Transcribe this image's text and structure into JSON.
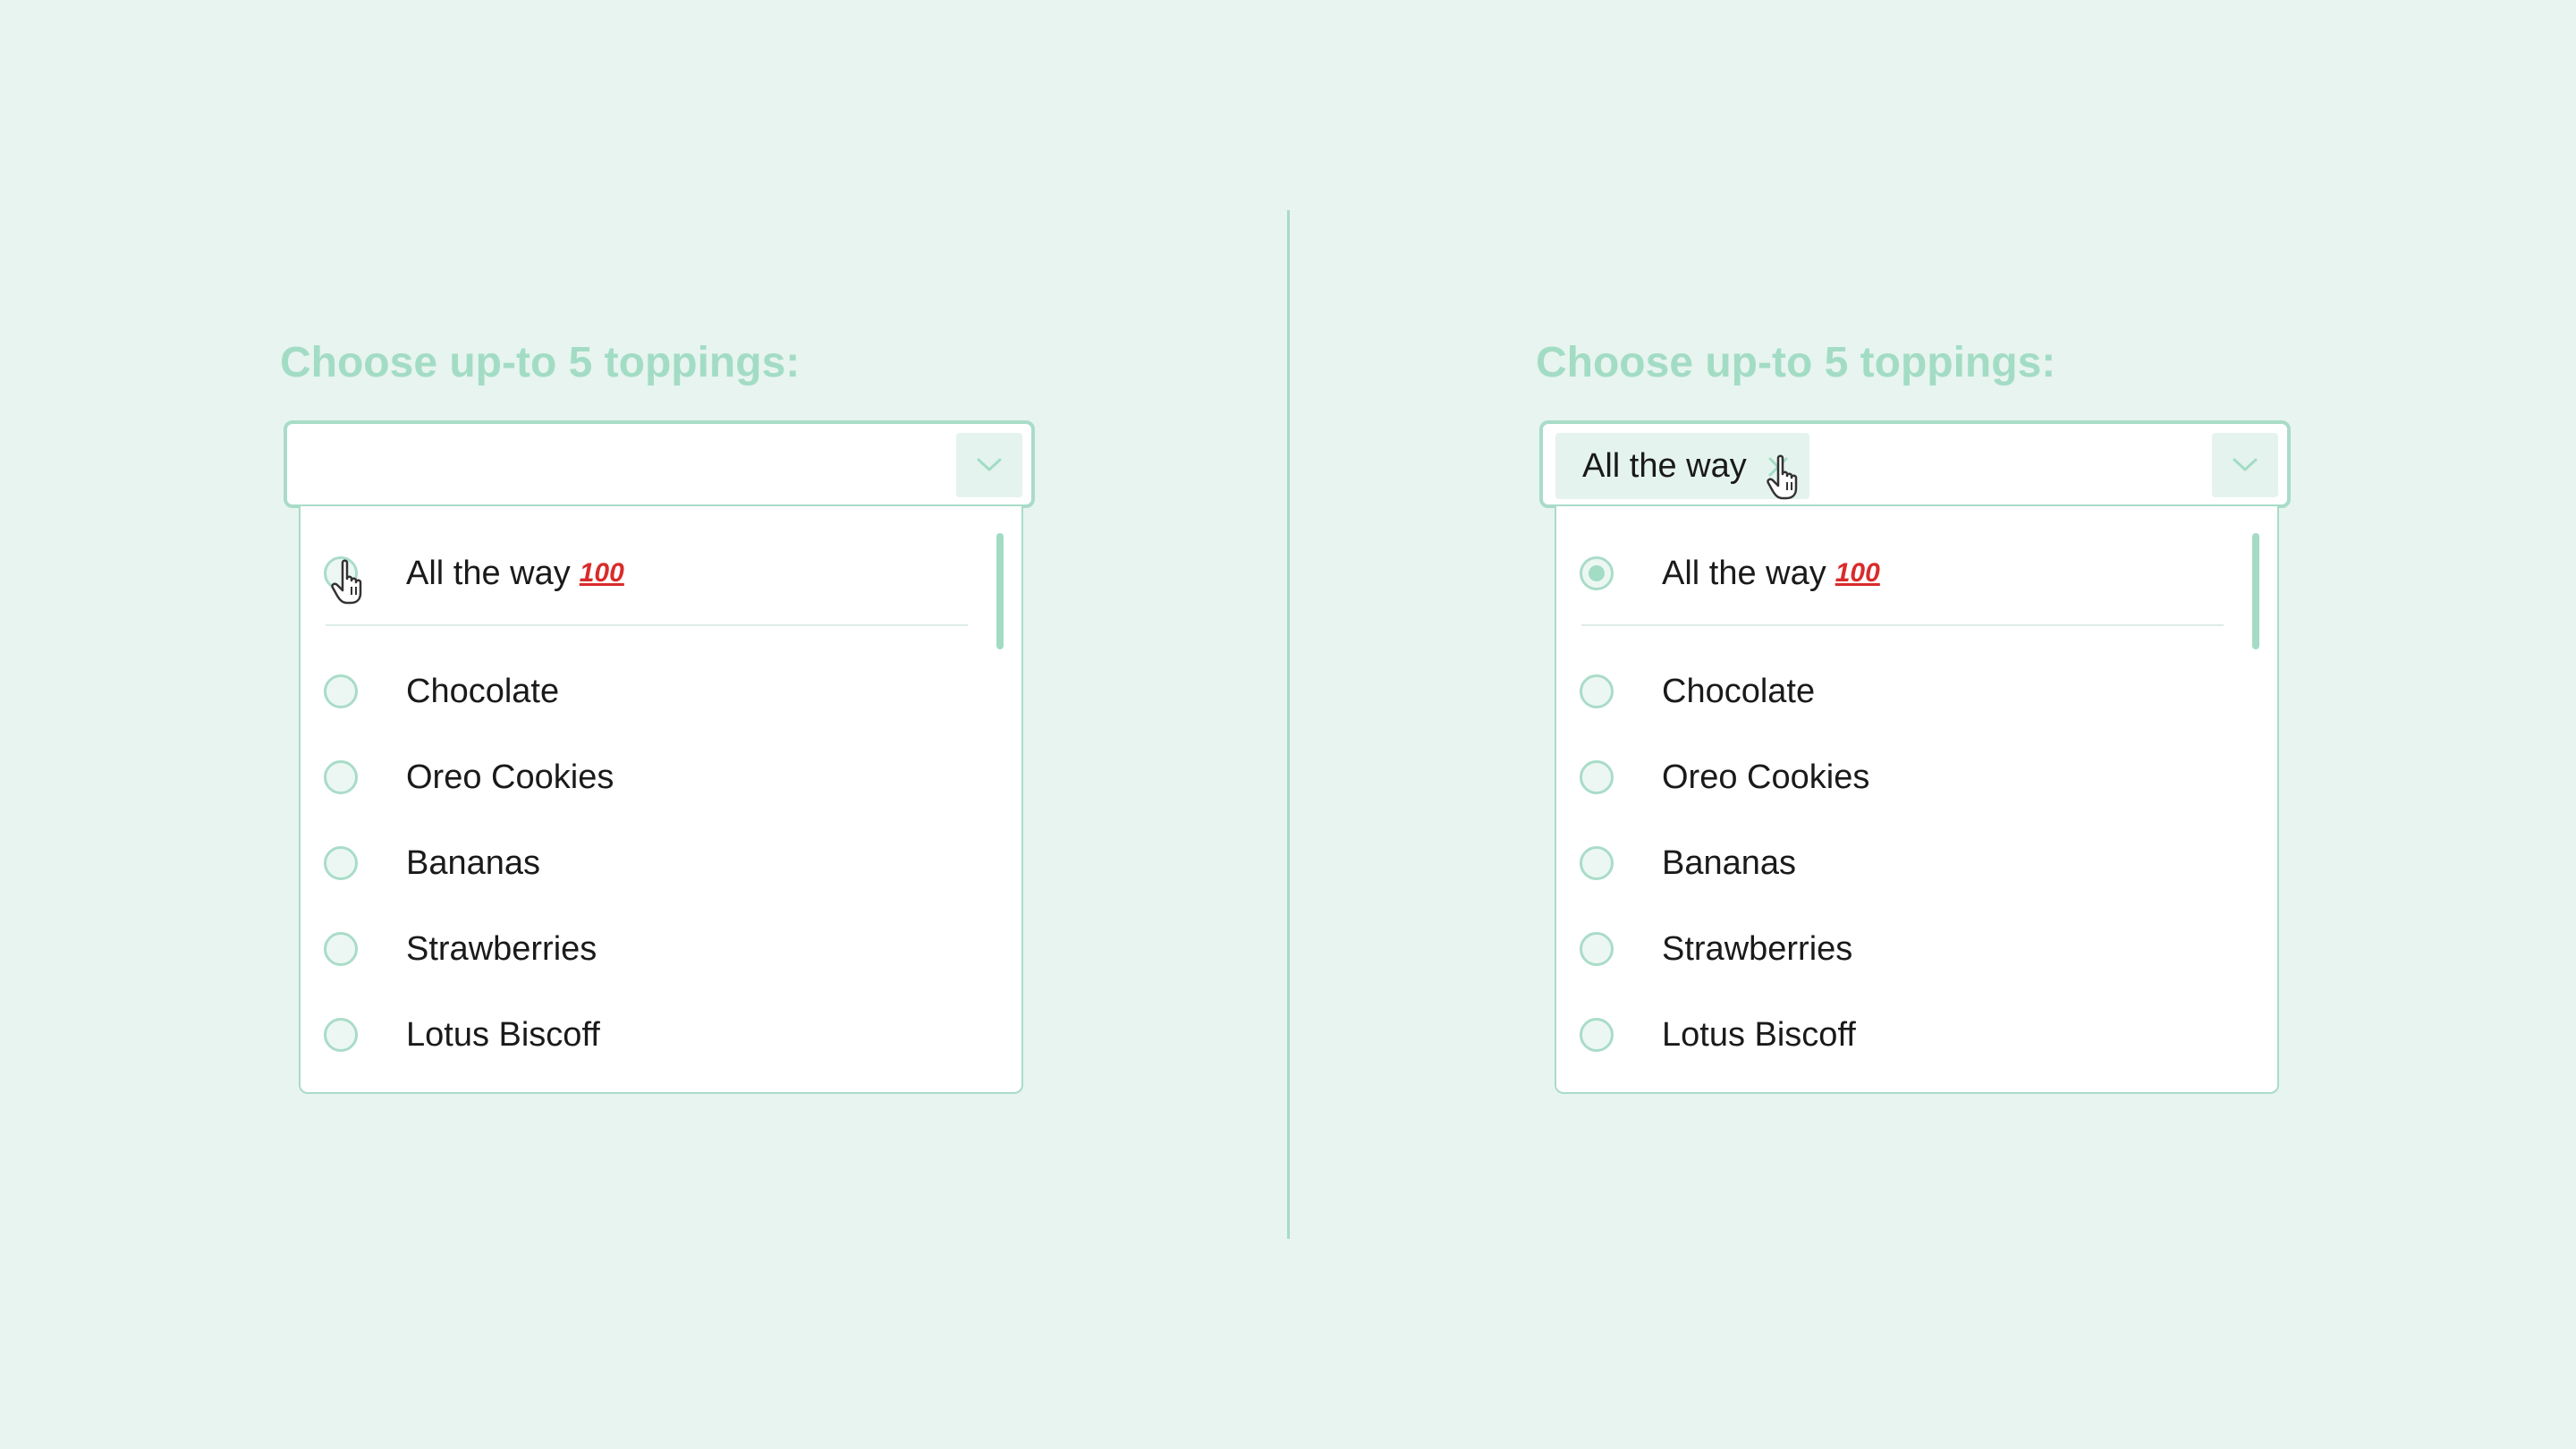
{
  "colors": {
    "background": "#e7f4ef",
    "accent": "#a3dcc5",
    "border": "#a9dcc8",
    "chip_bg": "#e4f3ed",
    "badge": "#d92b2b"
  },
  "panels": [
    {
      "state": "empty",
      "heading": "Choose up-to 5 toppings:",
      "selected_chip": null,
      "options": [
        {
          "label": "All the way",
          "badge": "100",
          "checked": false
        },
        {
          "label": "Chocolate",
          "checked": false
        },
        {
          "label": "Oreo Cookies",
          "checked": false
        },
        {
          "label": "Bananas",
          "checked": false
        },
        {
          "label": "Strawberries",
          "checked": false
        },
        {
          "label": "Lotus Biscoff",
          "checked": false
        }
      ],
      "cursor_icon": "hand-pointer-icon"
    },
    {
      "state": "selected",
      "heading": "Choose up-to 5 toppings:",
      "selected_chip": {
        "label": "All the way",
        "remove_icon": "close-icon"
      },
      "options": [
        {
          "label": "All the way",
          "badge": "100",
          "checked": true
        },
        {
          "label": "Chocolate",
          "checked": false
        },
        {
          "label": "Oreo Cookies",
          "checked": false
        },
        {
          "label": "Bananas",
          "checked": false
        },
        {
          "label": "Strawberries",
          "checked": false
        },
        {
          "label": "Lotus Biscoff",
          "checked": false
        }
      ],
      "cursor_icon": "hand-pointer-icon"
    }
  ]
}
